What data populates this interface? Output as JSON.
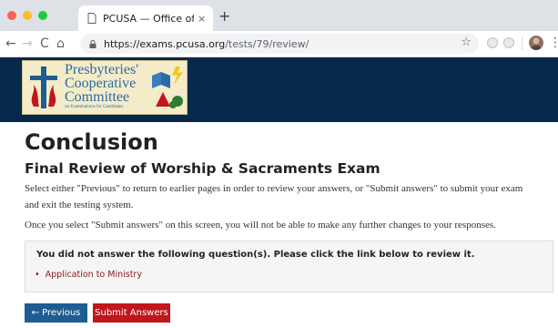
{
  "browser": {
    "tab_title": "PCUSA — Office of Vocation –",
    "tab_close": "×",
    "new_tab": "+",
    "url_host": "https://exams.pcusa.org",
    "url_path": "/tests/79/review/",
    "nav_back": "←",
    "nav_forward": "→",
    "nav_reload": "C",
    "nav_home": "⌂",
    "star": "☆",
    "menu": "⋮",
    "colors": {
      "close": "#ff5f57",
      "minimize": "#febc2e",
      "maximize": "#28c840"
    }
  },
  "banner": {
    "logo_line1": "Presbyteries'",
    "logo_line2": "Cooperative",
    "logo_line3": "Committee",
    "logo_line4": "on Examinations for Candidates",
    "background": "#06284a"
  },
  "page": {
    "title": "Conclusion",
    "subtitle": "Final Review of Worship & Sacraments Exam",
    "instructions_1": "Select either \"Previous\" to return to earlier pages in order to review your answers, or \"Submit answers\" to submit your exam and exit the testing system.",
    "instructions_2": "Once you select \"Submit answers\" on this screen, you will not be able to make any further changes to your responses.",
    "alert": {
      "title": "You did not answer the following question(s). Please click the link below to review it.",
      "items": [
        "Application to Ministry"
      ]
    },
    "buttons": {
      "previous": "← Previous",
      "submit": "Submit Answers"
    },
    "colors": {
      "previous": "#1f5c91",
      "submit": "#c0161c",
      "link": "#8b1a1a"
    }
  }
}
